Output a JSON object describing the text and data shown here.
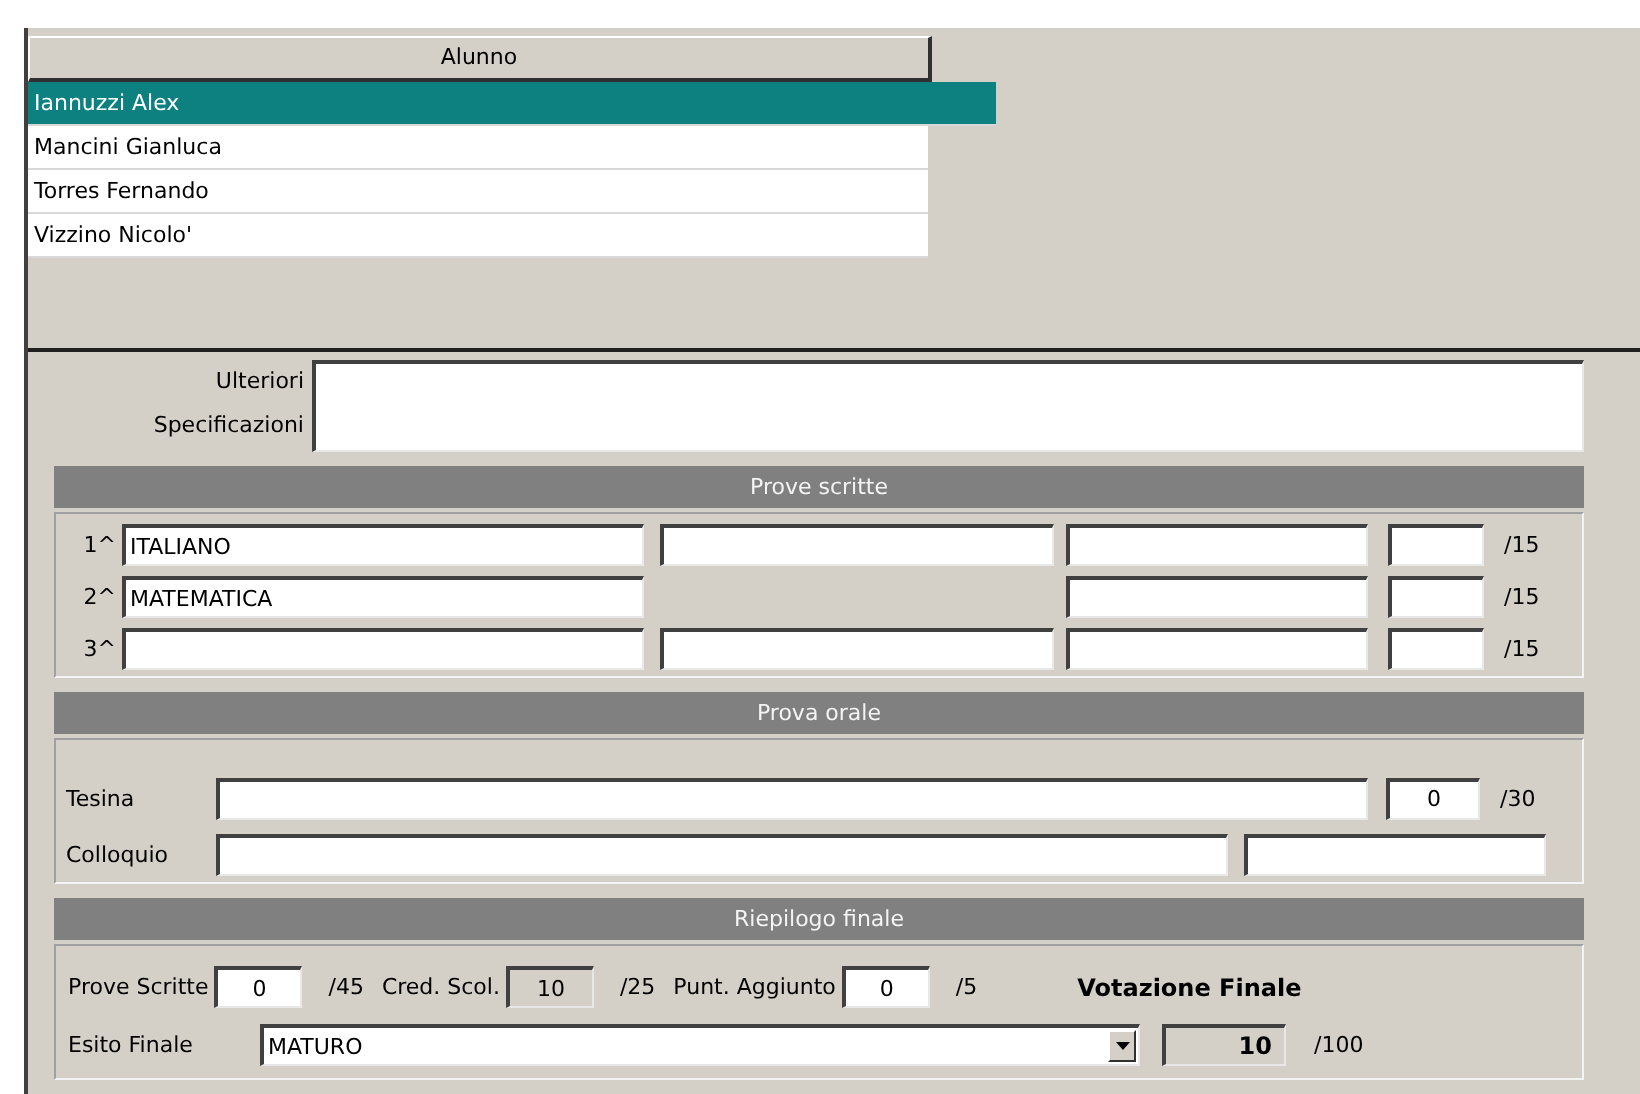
{
  "student_list": {
    "column": "Alunno",
    "rows": [
      {
        "name": "Iannuzzi Alex",
        "selected": true
      },
      {
        "name": "Mancini Gianluca",
        "selected": false
      },
      {
        "name": "Torres Fernando",
        "selected": false
      },
      {
        "name": "Vizzino Nicolo'",
        "selected": false
      }
    ]
  },
  "notes": {
    "label": "Ulteriori Specificazioni"
  },
  "written_tests": {
    "title": "Prove scritte",
    "rows": [
      {
        "label": "1^",
        "subject": "ITALIANO",
        "max": "/15",
        "kind": "full"
      },
      {
        "label": "2^",
        "subject": "MATEMATICA",
        "max": "/15",
        "kind": "partial"
      },
      {
        "label": "3^",
        "max": "/15",
        "kind": "full"
      }
    ]
  },
  "oral_test": {
    "title": "Prova orale",
    "tesina": {
      "label": "Tesina",
      "score": "0",
      "max": "/30"
    },
    "colloquio": {
      "label": "Colloquio"
    }
  },
  "summary": {
    "title": "Riepilogo finale",
    "written": {
      "label": "Prove Scritte",
      "value": "0",
      "max": "/45",
      "disabled": false
    },
    "credits": {
      "label": "Cred. Scol.",
      "value": "10",
      "max": "/25",
      "disabled": true
    },
    "bonus": {
      "label": "Punt. Aggiunto",
      "value": "0",
      "max": "/5",
      "disabled": false
    },
    "final_title": "Votazione Finale",
    "outcome": {
      "label": "Esito Finale",
      "value": "MATURO"
    },
    "final_score": {
      "value": "10",
      "max": "/100",
      "disabled": true
    }
  }
}
